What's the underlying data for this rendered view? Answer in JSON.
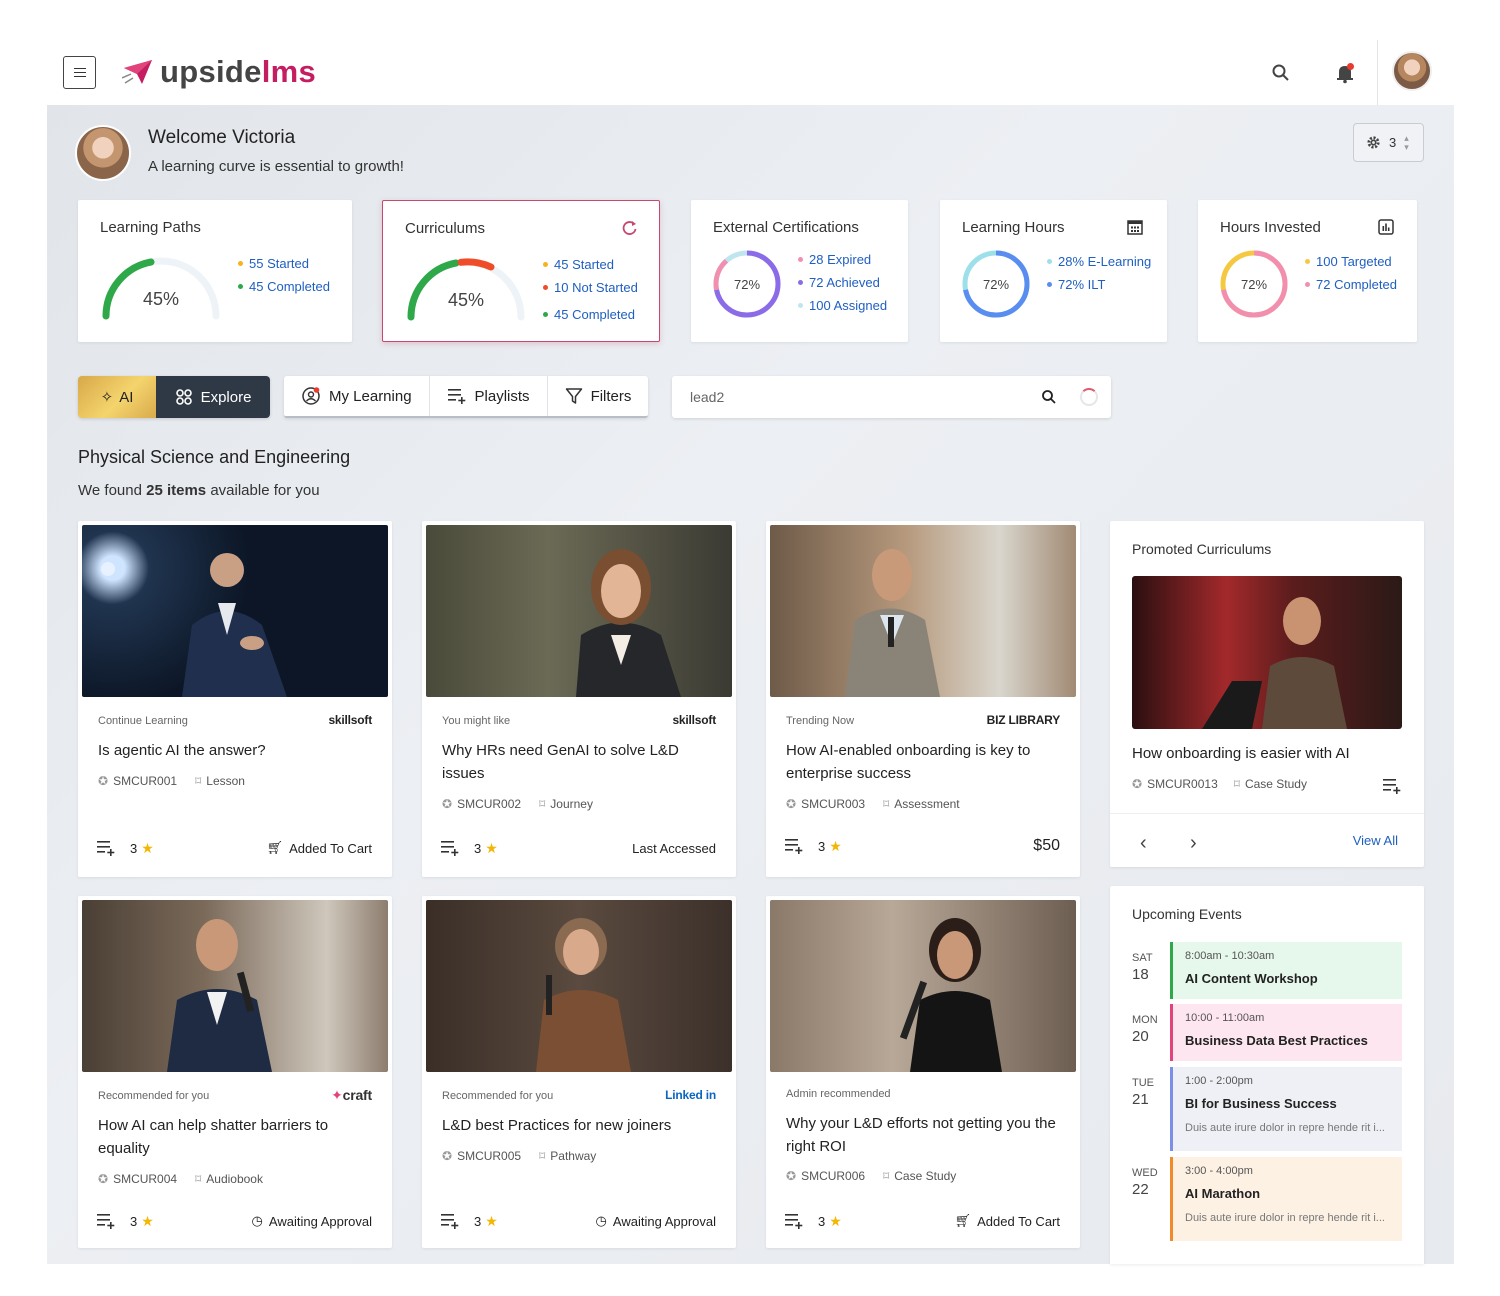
{
  "brand": {
    "name_a": "upside",
    "name_b": "lms",
    "accent": "#c51d61"
  },
  "header": {
    "search_icon": "search-icon",
    "bell_icon": "bell-icon"
  },
  "welcome": {
    "title": "Welcome Victoria",
    "subtitle": "A learning curve is essential to growth!",
    "settings_count": "3"
  },
  "stats": [
    {
      "title": "Learning Paths",
      "value": "45%",
      "percent": 45,
      "legend": [
        {
          "label": "55 Started",
          "color": "#f5b31e"
        },
        {
          "label": "45 Completed",
          "color": "#2fa84a"
        }
      ]
    },
    {
      "title": "Curriculums",
      "value": "45%",
      "percent": 45,
      "legend": [
        {
          "label": "45 Started",
          "color": "#f5b31e"
        },
        {
          "label": "10 Not Started",
          "color": "#ef4d2a"
        },
        {
          "label": "45 Completed",
          "color": "#2fa84a"
        }
      ]
    },
    {
      "title": "External Certifications",
      "value": "72%",
      "percent": 72,
      "legend": [
        {
          "label": "28 Expired",
          "color": "#f28fb0"
        },
        {
          "label": "72 Achieved",
          "color": "#8b6be8"
        },
        {
          "label": "100 Assigned",
          "color": "#bfe6ee"
        }
      ]
    },
    {
      "title": "Learning Hours",
      "value": "72%",
      "percent": 72,
      "legend": [
        {
          "label": "28% E-Learning",
          "color": "#9ee0ea"
        },
        {
          "label": "72% ILT",
          "color": "#5a8df0"
        }
      ]
    },
    {
      "title": "Hours Invested",
      "value": "72%",
      "percent": 72,
      "legend": [
        {
          "label": "100 Targeted",
          "color": "#f5c842"
        },
        {
          "label": "72 Completed",
          "color": "#f28fb0"
        }
      ]
    }
  ],
  "toolbar": {
    "ai_label": "AI",
    "explore_label": "Explore",
    "tabs": [
      "My Learning",
      "Playlists",
      "Filters"
    ],
    "search_value": "lead2"
  },
  "section": {
    "title": "Physical Science and Engineering",
    "sub_prefix": "We found ",
    "sub_count": "25 items",
    "sub_suffix": " available for you"
  },
  "courses": [
    {
      "label": "Continue Learning",
      "provider": "skillsoft",
      "title": "Is agentic AI the answer?",
      "code": "SMCUR001",
      "type": "Lesson",
      "rating": "3",
      "status": "Added To Cart"
    },
    {
      "label": "You might like",
      "provider": "skillsoft",
      "title": "Why HRs need GenAI to solve L&D issues",
      "code": "SMCUR002",
      "type": "Journey",
      "rating": "3",
      "status": "Last Accessed"
    },
    {
      "label": "Trending Now",
      "provider": "BIZ LIBRARY",
      "title": "How AI-enabled onboarding is key to enterprise success",
      "code": "SMCUR003",
      "type": "Assessment",
      "rating": "3",
      "status": "$50"
    },
    {
      "label": "Recommended for you",
      "provider": "craft",
      "title": "How AI can help shatter barriers to equality",
      "code": "SMCUR004",
      "type": "Audiobook",
      "rating": "3",
      "status": "Awaiting Approval"
    },
    {
      "label": "Recommended for you",
      "provider": "Linked in",
      "title": "L&D best Practices for new joiners",
      "code": "SMCUR005",
      "type": "Pathway",
      "rating": "3",
      "status": "Awaiting Approval"
    },
    {
      "label": "Admin recommended",
      "provider": "",
      "title": "Why your L&D efforts not getting you the right ROI",
      "code": "SMCUR006",
      "type": "Case Study",
      "rating": "3",
      "status": "Added To Cart"
    }
  ],
  "promoted": {
    "title": "Promoted Curriculums",
    "item_title": "How onboarding is easier with AI",
    "code": "SMCUR0013",
    "type": "Case Study",
    "view_all": "View All"
  },
  "events": {
    "title": "Upcoming Events",
    "items": [
      {
        "dow": "SAT",
        "day": "18",
        "time": "8:00am - 10:30am",
        "name": "AI Content Workshop",
        "desc": "",
        "color": "#2fa84a",
        "bg": "#e6f7ec"
      },
      {
        "dow": "MON",
        "day": "20",
        "time": "10:00 - 11:00am",
        "name": "Business Data Best Practices",
        "desc": "",
        "color": "#e0447a",
        "bg": "#fde6ef"
      },
      {
        "dow": "TUE",
        "day": "21",
        "time": "1:00 - 2:00pm",
        "name": "BI for Business Success",
        "desc": "Duis aute irure dolor in repre hende rit i...",
        "color": "#7b8fe6",
        "bg": "#eef0f5"
      },
      {
        "dow": "WED",
        "day": "22",
        "time": "3:00 - 4:00pm",
        "name": "AI Marathon",
        "desc": "Duis aute irure dolor in repre hende rit i...",
        "color": "#f08a2a",
        "bg": "#fdf1e4"
      }
    ]
  }
}
